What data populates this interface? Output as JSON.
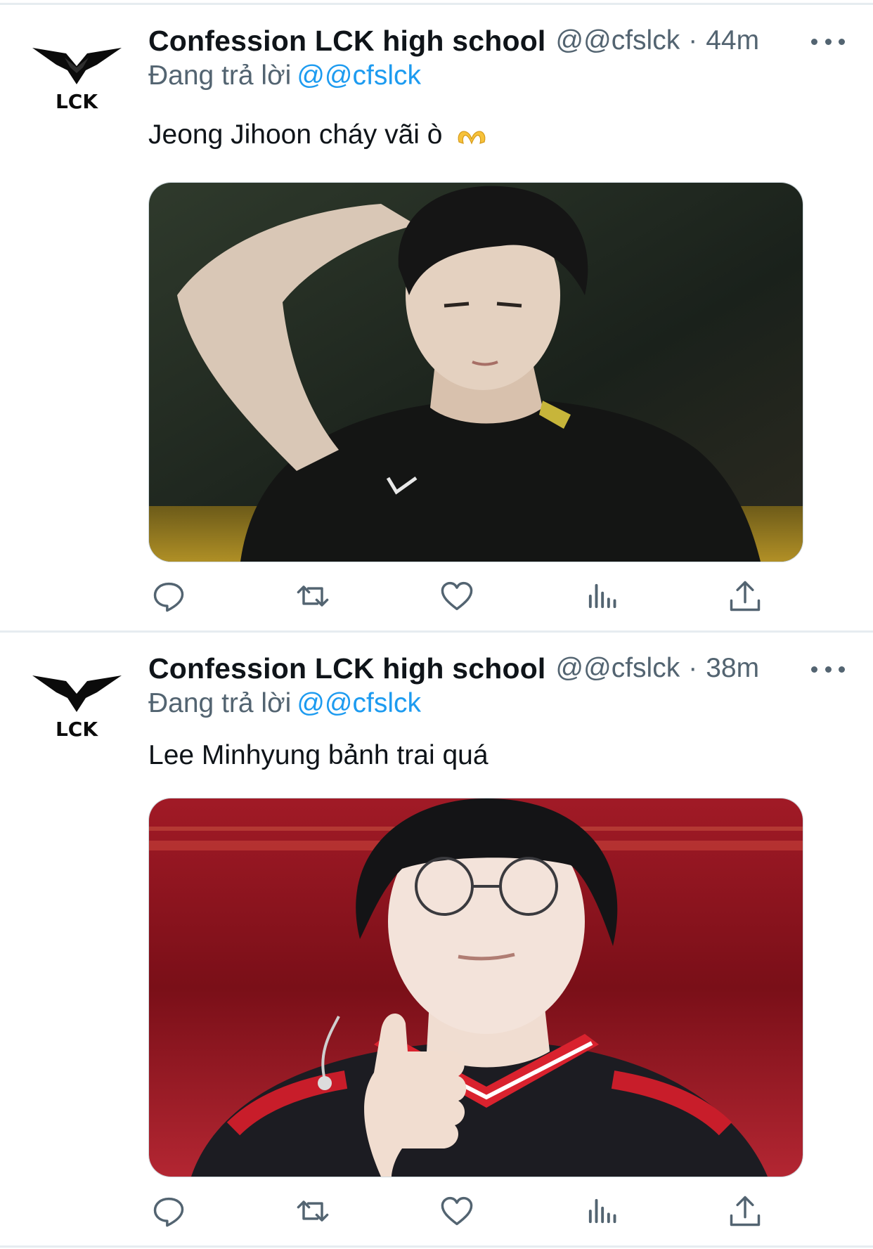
{
  "tweets": [
    {
      "author_name": "Confession LCK high school",
      "handle": "@@cfslck",
      "separator": "·",
      "time": "44m",
      "replying_label": "Đang trả lời",
      "replying_to": "@@cfslck",
      "text": "Jeong Jihoon cháy vãi ò",
      "text_emoji": "heart-hands-emoji",
      "avatar_text": "LCK",
      "media": "photo-player-black-jersey"
    },
    {
      "author_name": "Confession LCK high school",
      "handle": "@@cfslck",
      "separator": "·",
      "time": "38m",
      "replying_label": "Đang trả lời",
      "replying_to": "@@cfslck",
      "text": "Lee Minhyung bảnh trai quá",
      "avatar_text": "LCK",
      "media": "photo-player-red-jersey-thumbs-up"
    }
  ],
  "action_icons": [
    "reply-icon",
    "retweet-icon",
    "like-icon",
    "views-icon",
    "share-icon"
  ],
  "colors": {
    "link": "#1d9bf0",
    "secondary": "#536471",
    "text": "#0f1419",
    "divider": "#e6ecf0"
  }
}
